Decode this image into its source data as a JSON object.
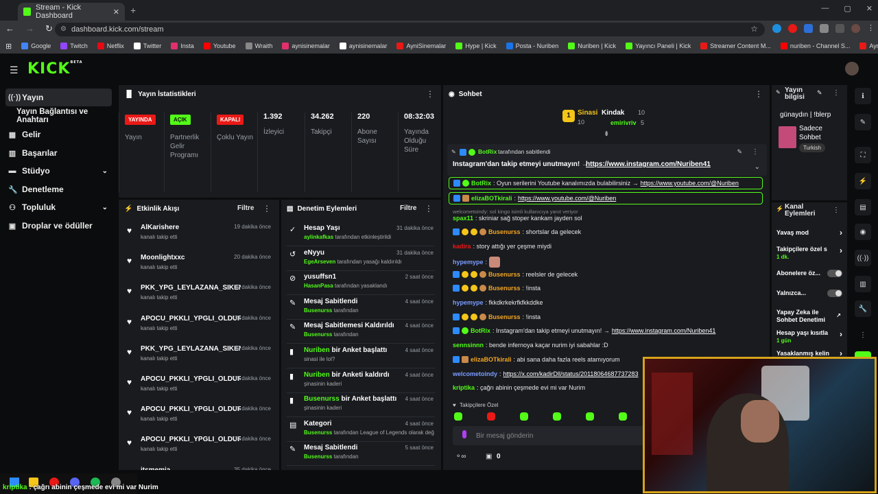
{
  "browser": {
    "tab_title": "Stream - Kick Dashboard",
    "tab_close": "✕",
    "new_tab": "+",
    "url": "dashboard.kick.com/stream",
    "bookmarks": [
      "Google",
      "Twitch",
      "Netflix",
      "Twitter",
      "Insta",
      "Youtube",
      "Wraith",
      "aynisinemalar",
      "aynisinemalar",
      "AyniSinemalar",
      "Hype | Kick",
      "Posta - Nuriben",
      "Nuriben | Kick",
      "Yayıncı Paneli | Kick",
      "Streamer Content M...",
      "nuriben - Channel S...",
      "Aynı Sinemalar - Ça..."
    ]
  },
  "header": {
    "logo": "KICK",
    "beta": "BETA"
  },
  "sidebar": {
    "items": [
      {
        "label": "Yayın",
        "icon": "broadcast-icon"
      },
      {
        "label": "Yayın Bağlantısı ve Anahtarı"
      },
      {
        "label": "Gelir",
        "icon": "money-icon"
      },
      {
        "label": "Başarılar",
        "icon": "trophy-icon"
      },
      {
        "label": "Stüdyo",
        "icon": "studio-icon"
      },
      {
        "label": "Denetleme",
        "icon": "wrench-icon"
      },
      {
        "label": "Topluluk",
        "icon": "people-icon"
      },
      {
        "label": "Droplar ve ödüller",
        "icon": "gift-icon"
      }
    ]
  },
  "stats": {
    "title": "Yayın İstatistikleri",
    "items": [
      {
        "badge": "YAYINDA",
        "label": "Yayın",
        "color": "#e91916"
      },
      {
        "badge": "AÇIK",
        "label": "Partnerlik Gelir Programı",
        "color": "#53fc18"
      },
      {
        "badge": "KAPALI",
        "label": "Çoklu Yayın",
        "color": "#e91916"
      },
      {
        "value": "1.392",
        "label": "İzleyici"
      },
      {
        "value": "34.262",
        "label": "Takipçi"
      },
      {
        "value": "220",
        "label": "Abone Sayısı"
      },
      {
        "value": "08:32:03",
        "label": "Yayında Olduğu Süre"
      }
    ]
  },
  "activity": {
    "title": "Etkinlik Akışı",
    "filter": "Filtre",
    "rows": [
      {
        "name": "AlKarishere",
        "sub": "kanalı takip etti",
        "time": "19 dakika önce"
      },
      {
        "name": "Moonlightxxc",
        "sub": "kanalı takip etti",
        "time": "20 dakika önce"
      },
      {
        "name": "PKK_YPG_LEYLAZANA_SIKEN",
        "sub": "kanalı takip etti",
        "time": "32 dakika önce"
      },
      {
        "name": "APOCU_PKKLI_YPGLI_OLDUREN",
        "sub": "kanalı takip etti",
        "time": "32 dakika önce"
      },
      {
        "name": "PKK_YPG_LEYLAZANA_SIKEN",
        "sub": "kanalı takip etti",
        "time": "32 dakika önce"
      },
      {
        "name": "APOCU_PKKLI_YPGLI_OLDUREN",
        "sub": "kanalı takip etti",
        "time": "32 dakika önce"
      },
      {
        "name": "APOCU_PKKLI_YPGLI_OLDUREN",
        "sub": "kanalı takip etti",
        "time": "33 dakika önce"
      },
      {
        "name": "APOCU_PKKLI_YPGLI_OLDUREN",
        "sub": "kanalı takip etti",
        "time": "34 dakika önce"
      },
      {
        "name": "itsmemia",
        "sub": "kanalı takip etti",
        "time": "35 dakika önce"
      }
    ]
  },
  "moderation": {
    "title": "Denetim Eylemleri",
    "filter": "Filtre",
    "rows": [
      {
        "icon": "✓",
        "title": "Hesap Yaşı",
        "g": "aylinkafkas",
        "sub": " tarafından etkinleştirildi",
        "time": "31 dakika önce"
      },
      {
        "icon": "↺",
        "title": "eNyyu",
        "g": "EgeArseven",
        "sub": " tarafından yasağı kaldırıldı",
        "time": "31 dakika önce"
      },
      {
        "icon": "⊘",
        "title": "yusuffsn1",
        "g": "HasanPasa",
        "sub": " tarafından yasaklandı",
        "time": "2 saat önce"
      },
      {
        "icon": "✎",
        "title": "Mesaj Sabitlendi",
        "g": "Busenurss",
        "sub": " tarafından",
        "time": "4 saat önce"
      },
      {
        "icon": "✎",
        "title": "Mesaj Sabitlemesi Kaldırıldı",
        "g": "Busenurss",
        "sub": " tarafından",
        "time": "4 saat önce"
      },
      {
        "icon": "▮",
        "title": "Nuriben",
        "title2": " bir Anket başlattı",
        "g": "",
        "sub": "sinasi ile lol?",
        "time": "4 saat önce"
      },
      {
        "icon": "▮",
        "title": "Nuriben",
        "title2": " bir Anketi kaldırdı",
        "g": "",
        "sub": "şinasinin kaderi",
        "time": "4 saat önce"
      },
      {
        "icon": "▮",
        "title": "Busenurss",
        "title2": " bir Anket başlattı",
        "g": "",
        "sub": "şinasinin kaderi",
        "time": "4 saat önce"
      },
      {
        "icon": "▤",
        "title": "Kategori",
        "g": "Busenurss",
        "sub": " tarafından League of Legends olarak değiştirildi",
        "time": "4 saat önce"
      },
      {
        "icon": "✎",
        "title": "Mesaj Sabitlendi",
        "g": "Busenurss",
        "sub": " tarafından",
        "time": "5 saat önce"
      }
    ]
  },
  "chat": {
    "title": "Sohbet",
    "top_gifters": [
      {
        "name": "Sinasi",
        "count": "10"
      },
      {
        "name": "Kindak",
        "count": "10"
      },
      {
        "name": "emirivriv",
        "count": "5"
      }
    ],
    "pinned_by": "BotRix",
    "pinned_by_suffix": " tarafından sabitlendi",
    "pinned_msg": "Instagram'dan takip etmeyi unutmayın! → ",
    "pinned_link": "https://www.instagram.com/Nuriben41",
    "lines": [
      {
        "u": "BotRix",
        "c": "#53fc18",
        "t": ": Oyun serilerini Youtube kanalımızda bulabilirsiniz → ",
        "l": "https://www.youtube.com/@Nuriben",
        "hl": true
      },
      {
        "u": "elizaBOTkirali",
        "c": "#53fc18",
        "t": ": ",
        "l": "https://www.youtube.com/@Nuriben",
        "hl": true
      },
      {
        "reply": "welcometoindy: sol kingo isimli kullanıcıya yanıt veriyor"
      },
      {
        "u": "spax11",
        "c": "#53fc18",
        "t": ": skriniar sağ stoper kankam jayden sol"
      },
      {
        "u": "Busenurss",
        "c": "#f5a623",
        "t": ": shortslar da gelecek"
      },
      {
        "u": "kadira",
        "c": "#e91916",
        "t": ": story attığı yer çeşme miydi"
      },
      {
        "u": "hypemype",
        "c": "#7a9cff",
        "t": ": "
      },
      {
        "u": "Busenurss",
        "c": "#f5a623",
        "t": ": reelsler de gelecek"
      },
      {
        "u": "Busenurss",
        "c": "#f5a623",
        "t": ": !insta"
      },
      {
        "u": "hypemype",
        "c": "#7a9cff",
        "t": ": fkkdkrkekrfkfkkddke"
      },
      {
        "u": "Busenurss",
        "c": "#f5a623",
        "t": ": !insta"
      },
      {
        "u": "BotRix",
        "c": "#53fc18",
        "t": ": Instagram'dan takip etmeyi unutmayın! → ",
        "l": "https://www.instagram.com/Nuriben41"
      },
      {
        "u": "sennsinnn",
        "c": "#53fc18",
        "t": ": bende infernoya kaçar nurim iyi sabahlar :D"
      },
      {
        "u": "elizaBOTkirali",
        "c": "#f5a623",
        "t": ": abi sana daha fazla reels atamıyorum"
      },
      {
        "u": "welcometoindy",
        "c": "#7a9cff",
        "t": ": ",
        "l": "https://x.com/kadirDll/status/20118064687737283"
      },
      {
        "u": "kriptika",
        "c": "#53fc18",
        "t": ": çağrı abinin çeşmede evi mi var Nurim"
      }
    ],
    "followers_only": "Takipçilere Özel",
    "input_placeholder": "Bir mesaj gönderin",
    "viewers_count": "0"
  },
  "stream_info": {
    "title": "Yayın bilgisi",
    "stream_title": "günaydın | !blerp",
    "category": "Sadece Sohbet",
    "tag": "Turkish"
  },
  "channel_actions": {
    "title": "Kanal Eylemleri",
    "items": [
      {
        "label": "Yavaş mod",
        "type": "chevron"
      },
      {
        "label": "Takipçilere özel s",
        "sub": "1 dk.",
        "type": "chevron"
      },
      {
        "label": "Abonelere öz...",
        "type": "toggle"
      },
      {
        "label": "Yalnızca...",
        "type": "toggle"
      },
      {
        "label": "Yapay Zeka ile Sohbet Denetimi",
        "type": "ext"
      },
      {
        "label": "Hesap yaşı kısıtla",
        "sub": "1 gün",
        "type": "chevron"
      },
      {
        "label": "Yasaklanmış kelin",
        "type": "chevron"
      }
    ]
  },
  "ticker": {
    "user": "kriptika",
    "text": " : çağrı abinin çeşmede evi mi var Nurim"
  },
  "colors": {
    "accent": "#53fc18",
    "live": "#e91916",
    "panel": "#191b1f",
    "bg": "#0b0c0d"
  }
}
